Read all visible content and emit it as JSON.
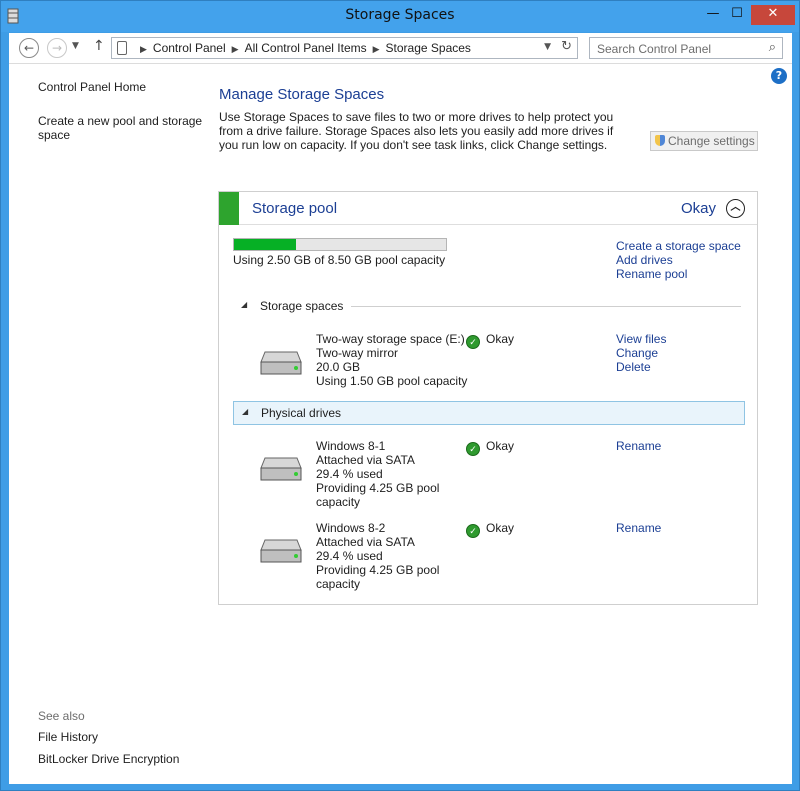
{
  "window": {
    "title": "Storage Spaces",
    "min": "—",
    "max": "☐",
    "close": "✕"
  },
  "nav": {
    "back": "←",
    "forward": "→",
    "up": "↑",
    "crumbs": [
      "Control Panel",
      "All Control Panel Items",
      "Storage Spaces"
    ],
    "search_placeholder": "Search Control Panel"
  },
  "sidebar": {
    "home": "Control Panel Home",
    "create_line1": "Create a new pool and storage",
    "create_line2": "space",
    "see_also": "See also",
    "file_history": "File History",
    "bitlocker": "BitLocker Drive Encryption"
  },
  "main": {
    "title": "Manage Storage Spaces",
    "description": "Use Storage Spaces to save files to two or more drives to help protect you from a drive failure. Storage Spaces also lets you easily add more drives if you run low on capacity. If you don't see task links, click Change settings.",
    "change_settings": "Change settings"
  },
  "pool": {
    "title": "Storage pool",
    "status": "Okay",
    "usage_text": "Using 2.50 GB of 8.50 GB pool capacity",
    "usage_fraction": 0.294,
    "links": [
      "Create a storage space",
      "Add drives",
      "Rename pool"
    ],
    "status_color": "#2ea42e"
  },
  "spaces": {
    "heading": "Storage spaces",
    "items": [
      {
        "lines": [
          "Two-way storage space (E:)",
          "Two-way mirror",
          "20.0 GB",
          "Using 1.50 GB pool capacity"
        ],
        "status": "Okay",
        "links": [
          "View files",
          "Change",
          "Delete"
        ]
      }
    ]
  },
  "drives": {
    "heading": "Physical drives",
    "items": [
      {
        "lines": [
          "Windows 8-1",
          "Attached via SATA",
          "29.4 % used",
          "Providing 4.25 GB pool",
          "capacity"
        ],
        "status": "Okay",
        "link": "Rename"
      },
      {
        "lines": [
          "Windows 8-2",
          "Attached via SATA",
          "29.4 % used",
          "Providing 4.25 GB pool",
          "capacity"
        ],
        "status": "Okay",
        "link": "Rename"
      }
    ]
  }
}
